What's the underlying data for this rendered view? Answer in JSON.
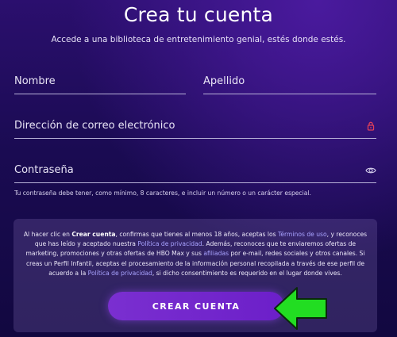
{
  "page": {
    "title": "Crea tu cuenta",
    "subtitle": "Accede a una biblioteca de entretenimiento genial, estés donde estés."
  },
  "form": {
    "first_name_label": "Nombre",
    "last_name_label": "Apellido",
    "email_label": "Dirección de correo electrónico",
    "password_label": "Contraseña",
    "password_hint": "Tu contraseña debe tener, como mínimo, 8 caracteres, e incluir un número o un carácter especial."
  },
  "terms": {
    "p1": "Al hacer clic en ",
    "create_account_bold": "Crear cuenta",
    "p2": ", confirmas que tienes al menos 18 años, aceptas los ",
    "terms_link": "Términos de uso",
    "p3": ", y reconoces que has leído y aceptado nuestra ",
    "privacy_link_1": "Política de privacidad",
    "p4": ". Además, reconoces que te enviaremos ofertas de marketing, promociones y otras ofertas de HBO Max y sus ",
    "affiliates_link": "afiliadas",
    "p5": " por e-mail, redes sociales y otros canales. Si creas un Perfil Infantil, aceptas el procesamiento de la información personal recopilada a través de ese perfil de acuerdo a la ",
    "privacy_link_2": "Política de privacidad",
    "p6": ", si dicho consentimiento es requerido en el lugar donde vives."
  },
  "cta": {
    "label": "CREAR CUENTA"
  },
  "icons": {
    "email_field_icon": "lock-icon",
    "password_field_icon": "eye-icon",
    "annotation": "green-arrow-icon"
  },
  "colors": {
    "background_top": "#2b0f6e",
    "background_bottom": "#120840",
    "button": "#6c1fc9",
    "link": "#a9a3ff",
    "lock_icon": "#e0405a",
    "arrow_fill": "#22dd22"
  }
}
